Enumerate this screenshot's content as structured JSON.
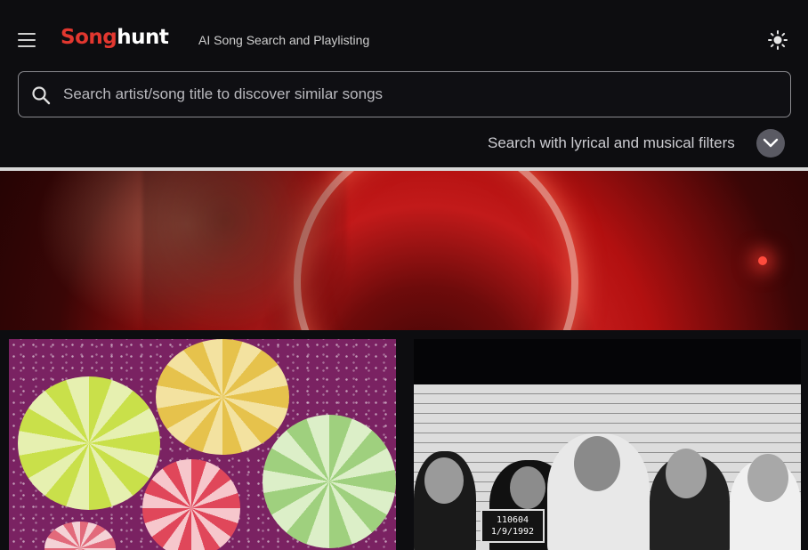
{
  "header": {
    "menu_icon": "hamburger-menu-icon",
    "logo_part1": "Song",
    "logo_part2": "hunt",
    "tagline": "AI Song Search and Playlisting",
    "theme_icon": "sun-icon"
  },
  "search": {
    "placeholder": "Search artist/song title to discover similar songs",
    "value": ""
  },
  "filters": {
    "label": "Search with lyrical and musical filters",
    "toggle_icon": "chevron-down-icon"
  },
  "cards": {
    "right_plate_line1": "110604",
    "right_plate_line2": "1/9/1992"
  },
  "colors": {
    "background": "#0d0d10",
    "brand_red": "#e2372f",
    "input_border": "#8a8a8f",
    "chevron_button": "#5a5a63"
  }
}
